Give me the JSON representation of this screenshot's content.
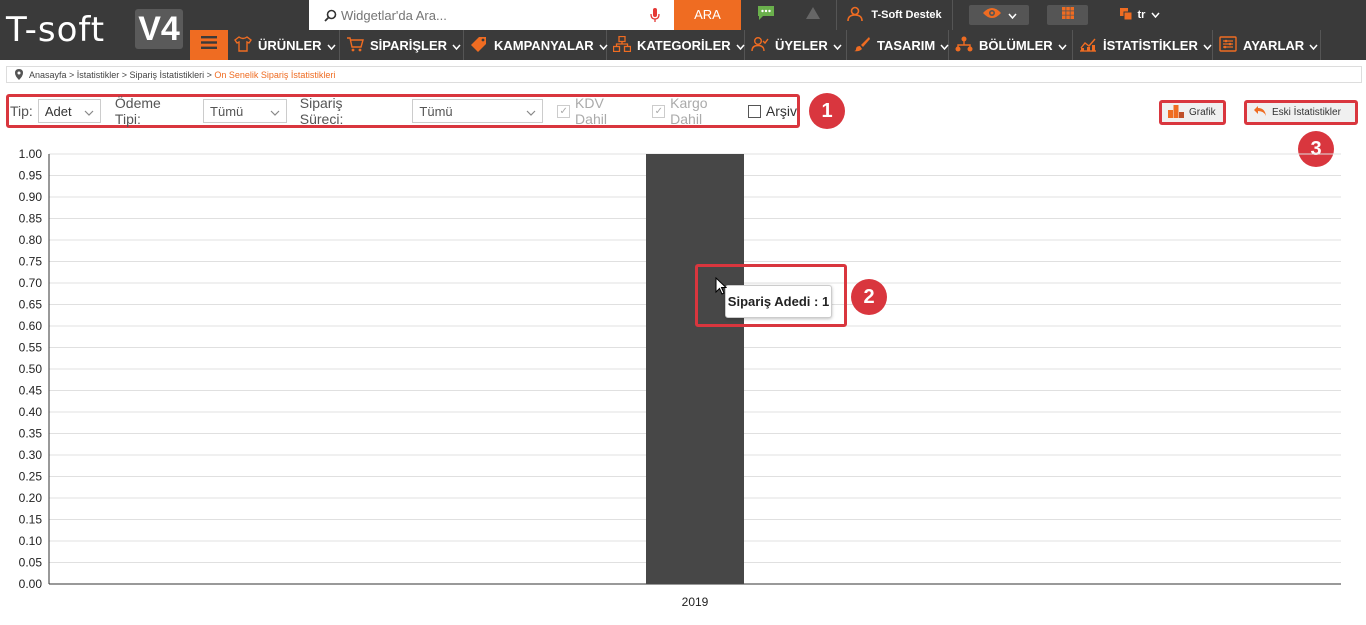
{
  "logo": {
    "brand": "T-soft",
    "version": "V4"
  },
  "search": {
    "placeholder": "Widgetlar'da Ara...",
    "button": "ARA"
  },
  "topbar": {
    "user": "T-Soft Destek",
    "language": "tr"
  },
  "nav": [
    {
      "label": "ÜRÜNLER",
      "icon": "product-icon"
    },
    {
      "label": "SİPARİŞLER",
      "icon": "cart-icon"
    },
    {
      "label": "KAMPANYALAR",
      "icon": "tag-icon"
    },
    {
      "label": "KATEGORİLER",
      "icon": "sitemap-icon"
    },
    {
      "label": "ÜYELER",
      "icon": "users-icon"
    },
    {
      "label": "TASARIM",
      "icon": "brush-icon"
    },
    {
      "label": "BÖLÜMLER",
      "icon": "sections-icon"
    },
    {
      "label": "İSTATİSTİKLER",
      "icon": "stats-icon"
    },
    {
      "label": "AYARLAR",
      "icon": "settings-icon"
    }
  ],
  "breadcrumb": {
    "path": "Anasayfa > İstatistikler > Sipariş İstatistikleri > ",
    "current": "On Senelik Sipariş İstatistikleri"
  },
  "filters": {
    "tip_label": "Tip:",
    "tip_value": "Adet",
    "odeme_label": "Ödeme Tipi:",
    "odeme_value": "Tümü",
    "surec_label": "Sipariş Süreci:",
    "surec_value": "Tümü",
    "kdv_label": "KDV Dahil",
    "kargo_label": "Kargo Dahil",
    "arsiv_label": "Arşiv"
  },
  "actions": {
    "grafik": "Grafik",
    "eski": "Eski İstatistikler"
  },
  "badges": [
    "1",
    "2",
    "3"
  ],
  "tooltip": "Sipariş Adedi : 1",
  "colors": {
    "accent": "#ef6c22",
    "dark": "#3a3a3a",
    "highlight": "#d9363e",
    "bar": "#474747"
  },
  "chart_data": {
    "type": "bar",
    "categories": [
      "2019"
    ],
    "series": [
      {
        "name": "Sipariş Adedi",
        "values": [
          1
        ]
      }
    ],
    "ylim": [
      0,
      1
    ],
    "yticks": [
      "0.00",
      "0.05",
      "0.10",
      "0.15",
      "0.20",
      "0.25",
      "0.30",
      "0.35",
      "0.40",
      "0.45",
      "0.50",
      "0.55",
      "0.60",
      "0.65",
      "0.70",
      "0.75",
      "0.80",
      "0.85",
      "0.90",
      "0.95",
      "1.00"
    ],
    "grid": true
  }
}
